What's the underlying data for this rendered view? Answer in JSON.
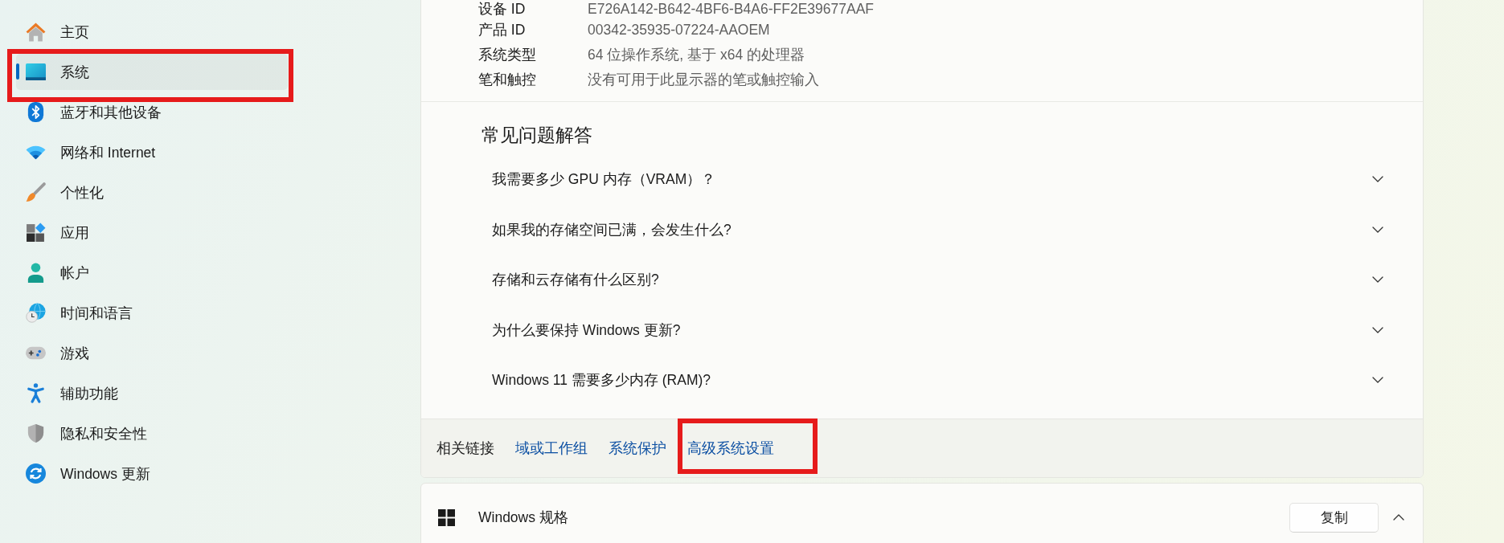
{
  "sidebar": {
    "items": [
      {
        "label": "主页",
        "selected": false,
        "highlighted": false
      },
      {
        "label": "系统",
        "selected": true,
        "highlighted": true
      },
      {
        "label": "蓝牙和其他设备",
        "selected": false,
        "highlighted": false
      },
      {
        "label": "网络和 Internet",
        "selected": false,
        "highlighted": false
      },
      {
        "label": "个性化",
        "selected": false,
        "highlighted": false
      },
      {
        "label": "应用",
        "selected": false,
        "highlighted": false
      },
      {
        "label": "帐户",
        "selected": false,
        "highlighted": false
      },
      {
        "label": "时间和语言",
        "selected": false,
        "highlighted": false
      },
      {
        "label": "游戏",
        "selected": false,
        "highlighted": false
      },
      {
        "label": "辅助功能",
        "selected": false,
        "highlighted": false
      },
      {
        "label": "隐私和安全性",
        "selected": false,
        "highlighted": false
      },
      {
        "label": "Windows 更新",
        "selected": false,
        "highlighted": false
      }
    ]
  },
  "device_specs": {
    "rows": [
      {
        "label": "设备 ID",
        "value": "E726A142-B642-4BF6-B4A6-FF2E39677AAF"
      },
      {
        "label": "产品 ID",
        "value": "00342-35935-07224-AAOEM"
      },
      {
        "label": "系统类型",
        "value": "64 位操作系统, 基于 x64 的处理器"
      },
      {
        "label": "笔和触控",
        "value": "没有可用于此显示器的笔或触控输入"
      }
    ]
  },
  "faq": {
    "title": "常见问题解答",
    "items": [
      {
        "question": "我需要多少 GPU 内存（VRAM）？",
        "expanded": false
      },
      {
        "question": "如果我的存储空间已满，会发生什么?",
        "expanded": false
      },
      {
        "question": "存储和云存储有什么区别?",
        "expanded": false
      },
      {
        "question": "为什么要保持 Windows 更新?",
        "expanded": false
      },
      {
        "question": "Windows 11 需要多少内存 (RAM)?",
        "expanded": false
      }
    ]
  },
  "related_links": {
    "label": "相关链接",
    "links": [
      {
        "label": "域或工作组",
        "highlighted": false
      },
      {
        "label": "系统保护",
        "highlighted": false
      },
      {
        "label": "高级系统设置",
        "highlighted": true
      }
    ]
  },
  "windows_specs": {
    "title": "Windows 规格",
    "copy_button": "复制",
    "expanded": true
  }
}
